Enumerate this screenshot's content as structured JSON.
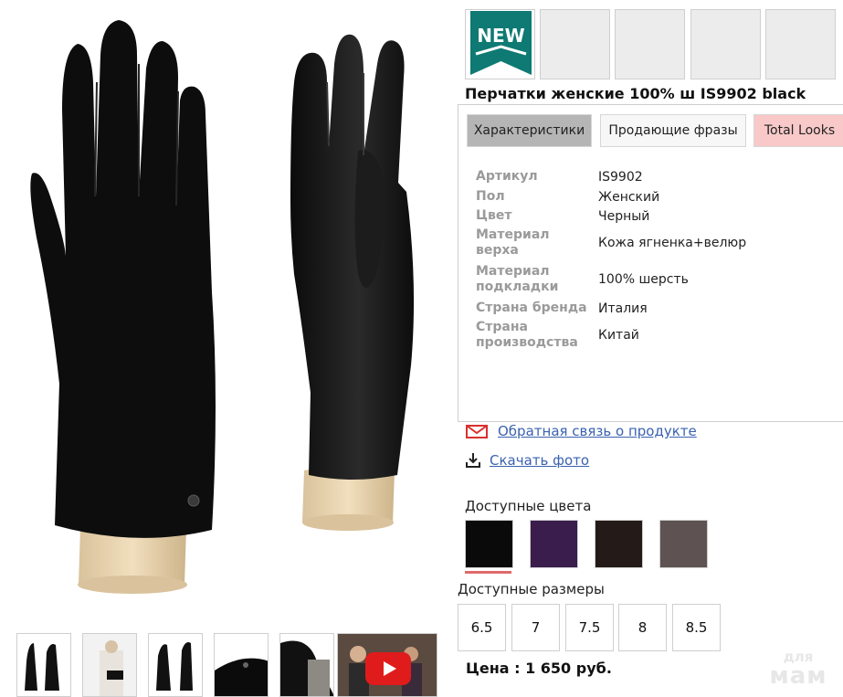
{
  "badge": {
    "new_label": "NEW",
    "accent": "#0e7a73"
  },
  "product": {
    "title": "Перчатки женские 100% ш IS9902 black",
    "price": "Цена : 1 650 руб."
  },
  "tabs": [
    {
      "label": "Характеристики",
      "active": true
    },
    {
      "label": "Продающие фразы",
      "active": false
    },
    {
      "label": "Total Looks",
      "active": false
    }
  ],
  "specs": [
    {
      "key": "Артикул",
      "value": "IS9902"
    },
    {
      "key": "Пол",
      "value": "Женский"
    },
    {
      "key": "Цвет",
      "value": "Черный"
    },
    {
      "key": "Материал верха",
      "value": "Кожа ягненка+велюр"
    },
    {
      "key": "Материал подкладки",
      "value": "100% шерсть"
    },
    {
      "key": "Страна бренда",
      "value": "Италия"
    },
    {
      "key": "Страна производства",
      "value": "Китай"
    }
  ],
  "links": {
    "feedback": {
      "label": "Обратная связь о продукте",
      "icon": "mail-icon"
    },
    "download": {
      "label": "Скачать фото",
      "icon": "download-icon"
    }
  },
  "colors": {
    "label": "Доступные цвета",
    "swatches": [
      "#0a0a0a",
      "#3a1d4d",
      "#241a17",
      "#5e5352"
    ],
    "selected_index": 0
  },
  "sizes": {
    "label": "Доступные размеры",
    "items": [
      "6.5",
      "7",
      "7.5",
      "8",
      "8.5"
    ]
  },
  "watermark": {
    "line1": "для",
    "line2": "мам"
  }
}
